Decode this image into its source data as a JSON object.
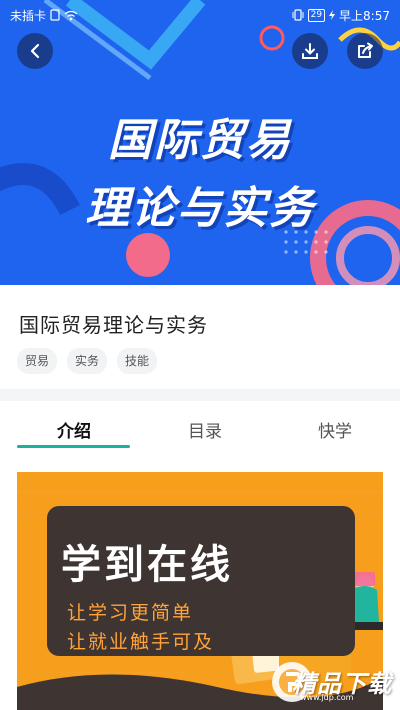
{
  "status_bar": {
    "carrier": "未插卡",
    "battery": "29",
    "time": "早上8:57"
  },
  "hero": {
    "title_line1": "国际贸易",
    "title_line2": "理论与实务"
  },
  "course": {
    "title": "国际贸易理论与实务",
    "tags": [
      "贸易",
      "实务",
      "技能"
    ]
  },
  "tabs": {
    "items": [
      {
        "label": "介绍",
        "active": true
      },
      {
        "label": "目录",
        "active": false
      },
      {
        "label": "快学",
        "active": false
      }
    ]
  },
  "poster": {
    "title": "学到在线",
    "line1": "让学习更简单",
    "line2": "让就业触手可及"
  },
  "watermark": {
    "text": "精品下载",
    "url": "www.jdp.com"
  },
  "icons": {
    "back": "chevron-left-icon",
    "download": "download-icon",
    "share": "share-icon"
  },
  "colors": {
    "hero_blue": "#1f64ee",
    "accent_teal": "#17b39a",
    "poster_orange": "#f79f1c",
    "poster_board": "#3e3532"
  }
}
